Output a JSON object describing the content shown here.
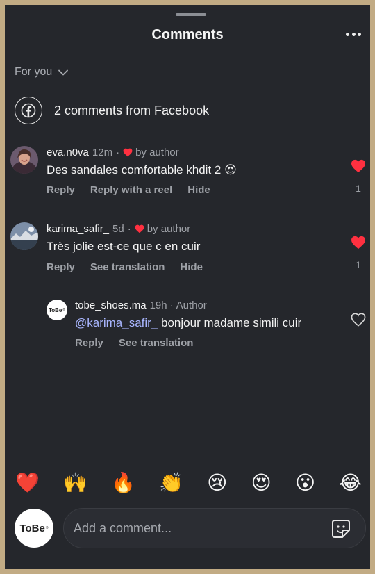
{
  "header": {
    "title": "Comments"
  },
  "filter": {
    "label": "For you"
  },
  "facebook_row": {
    "text": "2 comments from Facebook"
  },
  "comments": [
    {
      "username": "eva.n0va",
      "time": "12m",
      "separator": "·",
      "liked_label": "by author",
      "text": "Des sandales comfortable khdit 2 😍",
      "actions": [
        "Reply",
        "Reply with a reel",
        "Hide"
      ],
      "like_count": "1",
      "liked": true
    },
    {
      "username": "karima_safir_",
      "time": "5d",
      "separator": "·",
      "liked_label": "by author",
      "text": "Très jolie  est-ce que c en cuir",
      "actions": [
        "Reply",
        "See translation",
        "Hide"
      ],
      "like_count": "1",
      "liked": true
    }
  ],
  "reply": {
    "username": "tobe_shoes.ma",
    "time": "19h",
    "separator": "·",
    "role": "Author",
    "mention": "@karima_safir_",
    "text": " bonjour madame simili cuir",
    "actions": [
      "Reply",
      "See translation"
    ],
    "avatar_text": "ToBe",
    "avatar_mark": "®",
    "liked": false
  },
  "emoji_bar": [
    "❤️",
    "🙌",
    "🔥",
    "👏",
    "😢",
    "😍",
    "😮",
    "😂"
  ],
  "composer": {
    "avatar_text": "ToBe",
    "avatar_mark": "®",
    "placeholder": "Add a comment..."
  },
  "colors": {
    "background": "#25272c",
    "frame": "#c2ab84",
    "like_red": "#ff3040",
    "muted_text": "#9ea1a7",
    "mention": "#a9b6ff"
  },
  "icons": [
    "more-icon",
    "chevron-down-icon",
    "facebook-icon",
    "heart-icon",
    "sticker-icon"
  ]
}
